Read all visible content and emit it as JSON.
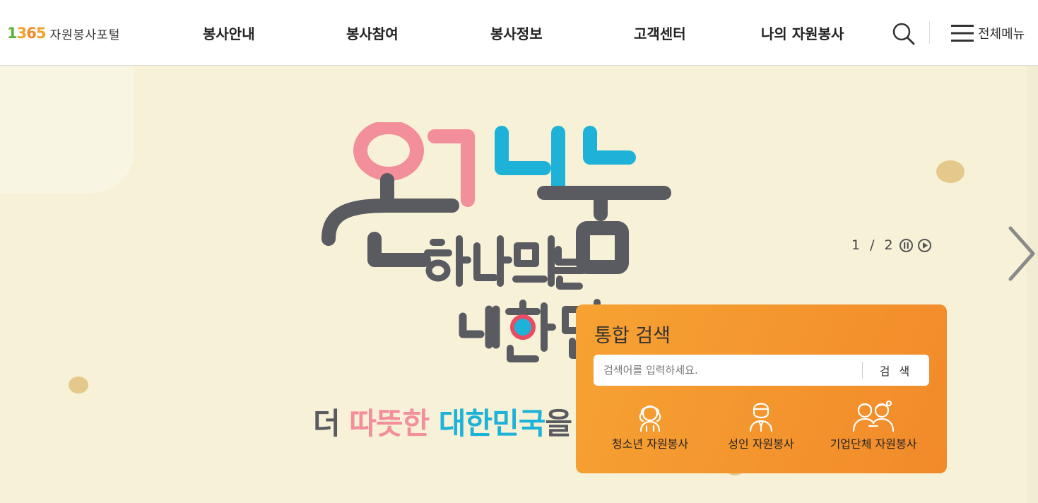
{
  "brand": {
    "logo_number": "1365",
    "logo_text": "자원봉사포털"
  },
  "nav": {
    "items": [
      {
        "label": "봉사안내"
      },
      {
        "label": "봉사참여"
      },
      {
        "label": "봉사정보"
      },
      {
        "label": "고객센터"
      },
      {
        "label": "나의 자원봉사"
      }
    ],
    "search_icon": "search-icon",
    "all_menu_label": "전체메뉴",
    "all_menu_icon": "hamburger-icon"
  },
  "hero": {
    "slogan_parts": [
      "더 ",
      "따뜻한",
      " 대한민국",
      "을 만듭니다!"
    ],
    "colors": {
      "pink": "#f28f9a",
      "blue": "#1fb2d8",
      "gray": "#5a5a61",
      "background": "#f6f1d7"
    }
  },
  "slider": {
    "current": "1",
    "separator": "/",
    "total": "2",
    "pause_icon": "pause-icon",
    "play_icon": "play-icon",
    "next_icon": "chevron-right-icon"
  },
  "search": {
    "title": "통합 검색",
    "placeholder": "검색어를 입력하세요.",
    "value": "",
    "button_label": "검 색",
    "categories": [
      {
        "label": "청소년 자원봉사",
        "icon": "youth-icon"
      },
      {
        "label": "성인 자원봉사",
        "icon": "adult-icon"
      },
      {
        "label": "기업단체 자원봉사",
        "icon": "group-icon"
      }
    ],
    "colors": {
      "panel_start": "#f6a233",
      "panel_end": "#f28a2a"
    }
  }
}
